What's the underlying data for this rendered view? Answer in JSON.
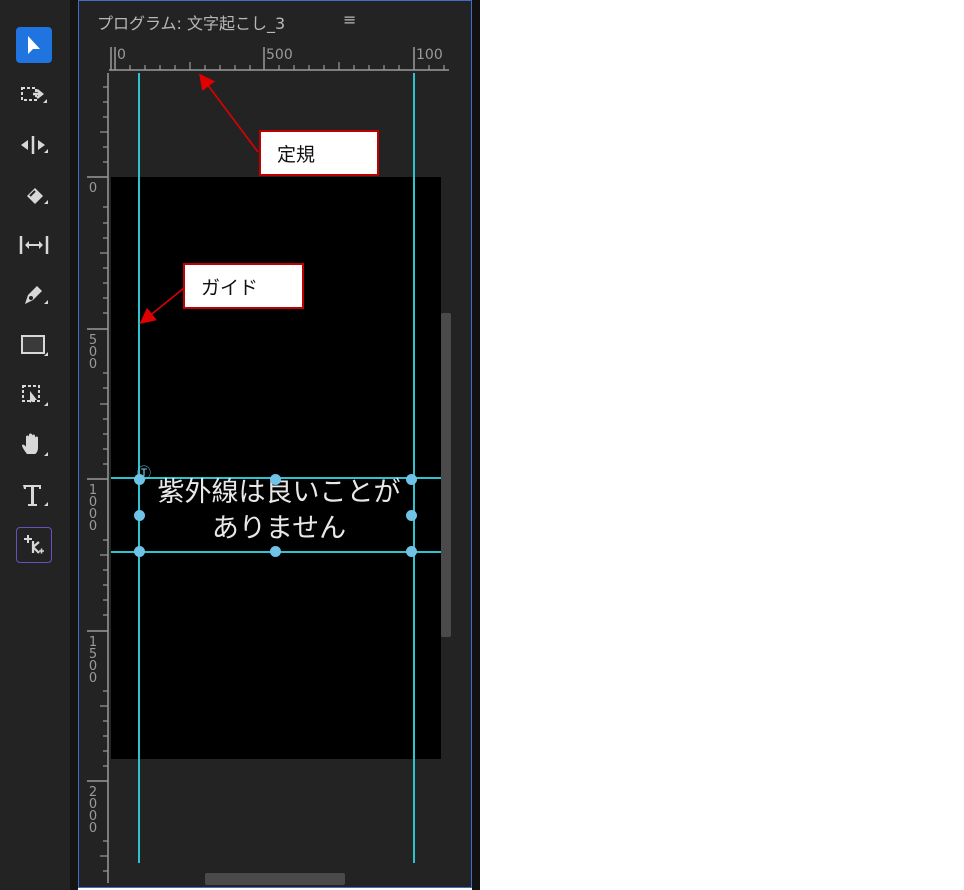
{
  "panel": {
    "title": "プログラム: 文字起こし_3",
    "menu_glyph": "≡"
  },
  "ruler_h_labels": [
    "0",
    "500",
    "100"
  ],
  "ruler_v_labels": [
    "0",
    "500",
    "1000",
    "1500",
    "2000"
  ],
  "caption": {
    "line1": "紫外線は良いことが",
    "line2": "ありません"
  },
  "callouts": {
    "ruler": "定規",
    "guide": "ガイド"
  },
  "colors": {
    "accent": "#1f74e0",
    "guide": "#2fc3d0",
    "callout_border": "#c00000"
  }
}
